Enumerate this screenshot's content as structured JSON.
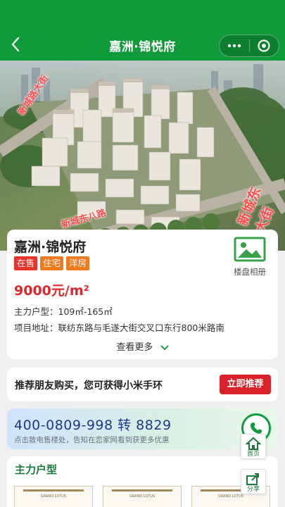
{
  "nav": {
    "title": "嘉洲·锦悦府",
    "back_icon": "chevron-left-icon",
    "more_icon": "more-dots-icon",
    "close_icon": "target-circle-icon"
  },
  "hero": {
    "road_left": "新城路大街",
    "road_bottom": "新城东八路",
    "road_right": "新城东大街"
  },
  "project": {
    "name": "嘉洲·锦悦府",
    "tags": [
      {
        "label": "在售",
        "color": "#e8332c"
      },
      {
        "label": "住宅",
        "color": "#f07a1e"
      },
      {
        "label": "洋房",
        "color": "#f07a1e"
      }
    ],
    "album_label": "楼盘相册",
    "price": "9000元/m²",
    "unit_type_key": "主力户型：",
    "unit_type_value": "109㎡-165㎡",
    "address_key": "项目地址：",
    "address_value": "联纺东路与毛遂大街交叉口东行800米路南",
    "see_more": "查看更多"
  },
  "referral": {
    "text": "推荐朋友购买，您可获得小米手环",
    "button": "立即推荐"
  },
  "hotline": {
    "number": "400-0809-998 转 8829",
    "subtitle": "点击致电售楼处，告知在恋家网看到获更多优惠"
  },
  "units": {
    "title": "主力户型",
    "thumbs": [
      "GRAND LOTUS",
      "GRAND LOTUS",
      "GRAND LOTUS"
    ]
  },
  "floating": {
    "home_label": "首页",
    "share_label": "分享"
  },
  "colors": {
    "brand_green": "#0f9b3a",
    "price_red": "#e0262a",
    "cta_red": "#d9212a"
  }
}
